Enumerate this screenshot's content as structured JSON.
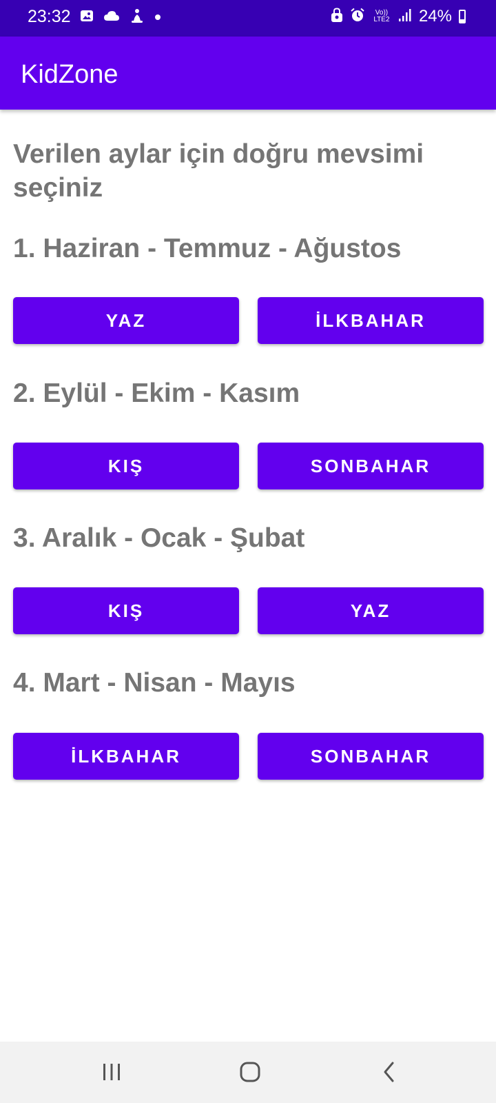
{
  "status_bar": {
    "time": "23:32",
    "battery_text": "24%",
    "network_label": "Vo)) LTE2",
    "icons_left": [
      "image-icon",
      "cloud-icon",
      "running-icon",
      "dot-icon"
    ],
    "icons_right": [
      "lock-icon",
      "alarm-icon",
      "volte-icon",
      "signal-icon",
      "battery-icon"
    ],
    "battery_level": 0.24,
    "background_color": "#3700b3"
  },
  "app_bar": {
    "title": "KidZone",
    "background_color": "#6200ee"
  },
  "main": {
    "instruction": "Verilen aylar için doğru mevsimi seçiniz",
    "questions": [
      {
        "text": "1. Haziran - Temmuz - Ağustos",
        "options": [
          "YAZ",
          "İLKBAHAR"
        ]
      },
      {
        "text": "2. Eylül - Ekim - Kasım",
        "options": [
          "KIŞ",
          "SONBAHAR"
        ]
      },
      {
        "text": "3. Aralık - Ocak - Şubat",
        "options": [
          "KIŞ",
          "YAZ"
        ]
      },
      {
        "text": "4. Mart - Nisan - Mayıs",
        "options": [
          "İLKBAHAR",
          "SONBAHAR"
        ]
      }
    ],
    "button_color": "#6200ee",
    "text_color": "#757575"
  },
  "nav_bar": {
    "buttons": [
      "recent-apps-icon",
      "home-icon",
      "back-icon"
    ]
  }
}
